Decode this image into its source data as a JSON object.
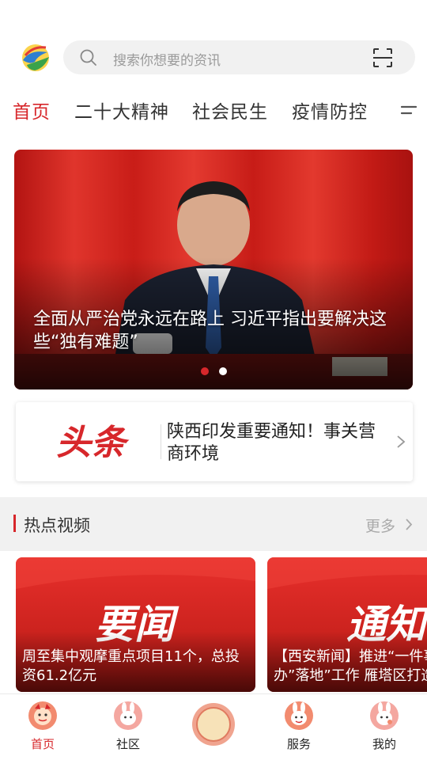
{
  "header": {
    "search_placeholder": "搜索你想要的资讯"
  },
  "tabs": [
    {
      "label": "首页",
      "active": true
    },
    {
      "label": "二十大精神",
      "active": false
    },
    {
      "label": "社会民生",
      "active": false
    },
    {
      "label": "疫情防控",
      "active": false
    }
  ],
  "banner": {
    "title": "全面从严治党永远在路上  习近平指出要解决这些“独有难题”",
    "current_slide": 1,
    "slide_count": 2
  },
  "headline": {
    "badge": "头条",
    "text": "陕西印发重要通知！事关营商环境"
  },
  "hot_videos": {
    "title": "热点视频",
    "more_label": "更多",
    "items": [
      {
        "tag": "要闻",
        "title": "周至集中观摩重点项目11个，总投资61.2亿元"
      },
      {
        "tag": "通知",
        "title": "【西安新闻】推进“一件事一次办”落地”工作  雁塔区打造"
      }
    ]
  },
  "bottom_nav": [
    {
      "label": "首页",
      "icon": "home-icon",
      "active": true
    },
    {
      "label": "社区",
      "icon": "community-icon",
      "active": false
    },
    {
      "label": "",
      "icon": "center-icon",
      "active": false
    },
    {
      "label": "服务",
      "icon": "service-icon",
      "active": false
    },
    {
      "label": "我的",
      "icon": "profile-icon",
      "active": false
    }
  ],
  "colors": {
    "accent": "#d7272b",
    "search_bg": "#f1f1f1"
  }
}
